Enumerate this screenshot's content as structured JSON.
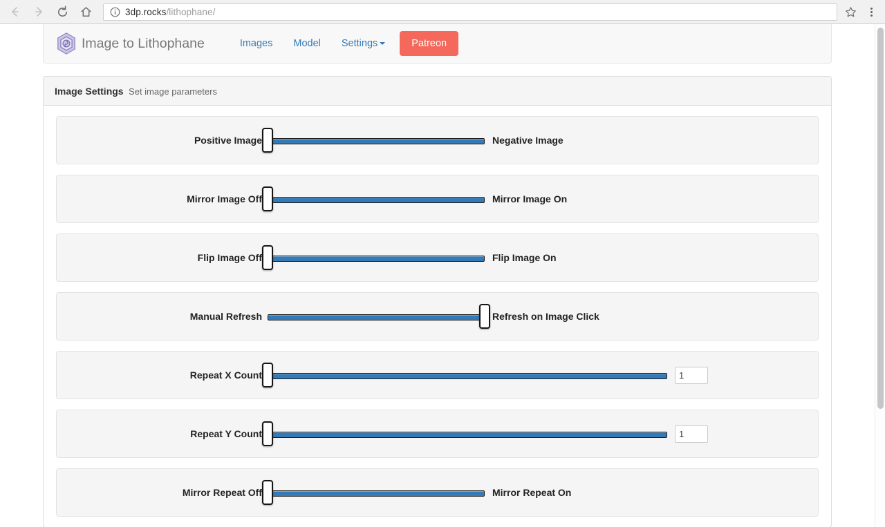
{
  "browser": {
    "back_icon": "back-arrow-icon",
    "forward_icon": "forward-arrow-icon",
    "reload_icon": "reload-icon",
    "home_icon": "home-icon",
    "info_icon": "info-circle-icon",
    "star_icon": "bookmark-star-icon",
    "menu_icon": "three-dot-menu-icon",
    "url_host": "3dp.rocks",
    "url_path": "/lithophane/",
    "url_full": "3dp.rocks/lithophane/"
  },
  "navbar": {
    "logo_icon": "hexagon-logo-icon",
    "brand": "Image to Lithophane",
    "links": [
      {
        "label": "Images"
      },
      {
        "label": "Model"
      },
      {
        "label": "Settings",
        "has_caret": true
      }
    ],
    "patreon_label": "Patreon",
    "patreon_color": "#f4695b",
    "link_color": "#337ab7"
  },
  "panel": {
    "title": "Image Settings",
    "subtitle": "Set image parameters"
  },
  "settings": [
    {
      "name": "positive-negative-image",
      "left_label": "Positive Image",
      "right_label": "Negative Image",
      "type": "toggle",
      "handle": "left",
      "value": "Positive Image"
    },
    {
      "name": "mirror-image",
      "left_label": "Mirror Image Off",
      "right_label": "Mirror Image On",
      "type": "toggle",
      "handle": "left",
      "value": "Mirror Image Off"
    },
    {
      "name": "flip-image",
      "left_label": "Flip Image Off",
      "right_label": "Flip Image On",
      "type": "toggle",
      "handle": "left",
      "value": "Flip Image Off"
    },
    {
      "name": "refresh-mode",
      "left_label": "Manual Refresh",
      "right_label": "Refresh on Image Click",
      "type": "toggle",
      "handle": "right",
      "value": "Refresh on Image Click"
    },
    {
      "name": "repeat-x-count",
      "left_label": "Repeat X Count",
      "right_label": "",
      "type": "count",
      "handle": "left",
      "value": "1"
    },
    {
      "name": "repeat-y-count",
      "left_label": "Repeat Y Count",
      "right_label": "",
      "type": "count",
      "handle": "left",
      "value": "1"
    },
    {
      "name": "mirror-repeat",
      "left_label": "Mirror Repeat Off",
      "right_label": "Mirror Repeat On",
      "type": "toggle",
      "handle": "left",
      "value": "Mirror Repeat Off"
    }
  ],
  "slider_colors": {
    "track": "#337ab7",
    "handle": "#ffffff",
    "handle_border": "#161616"
  }
}
